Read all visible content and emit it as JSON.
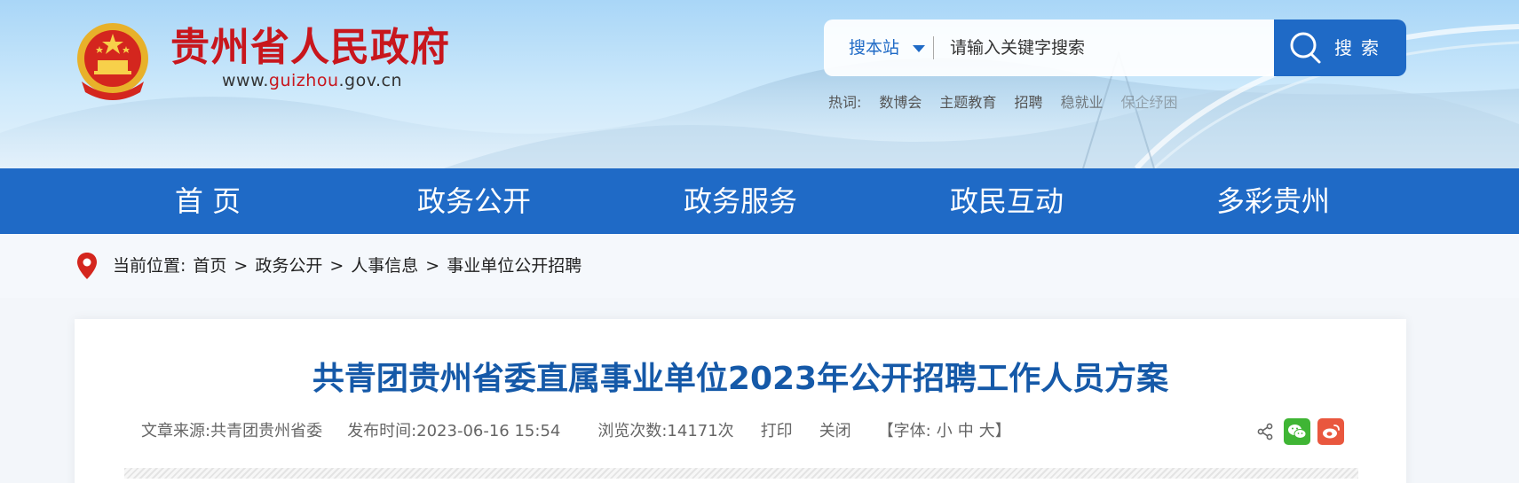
{
  "header": {
    "site_title": "贵州省人民政府",
    "domain_prefix": "www.",
    "domain_highlight": "guizhou",
    "domain_suffix": ".gov.cn"
  },
  "search": {
    "scope_label": "搜本站",
    "placeholder": "请输入关键字搜索",
    "button_label": "搜索"
  },
  "hotwords": {
    "label": "热词:",
    "items": [
      "数博会",
      "主题教育",
      "招聘",
      "稳就业",
      "保企纾困"
    ]
  },
  "nav": {
    "items": [
      "首 页",
      "政务公开",
      "政务服务",
      "政民互动",
      "多彩贵州"
    ]
  },
  "breadcrumb": {
    "label": "当前位置:",
    "items": [
      "首页",
      "政务公开",
      "人事信息",
      "事业单位公开招聘"
    ],
    "separator": ">"
  },
  "article": {
    "title": "共青团贵州省委直属事业单位2023年公开招聘工作人员方案",
    "source": "文章来源:共青团贵州省委",
    "publish_time": "发布时间:2023-06-16 15:54",
    "views": "浏览次数:14171次",
    "print": "打印",
    "close": "关闭",
    "font_label": "【字体:",
    "font_small": "小",
    "font_medium": "中",
    "font_large": "大",
    "font_end": "】"
  },
  "colors": {
    "brand_blue": "#1f6ac6",
    "title_red": "#c8161d",
    "article_title": "#1559a8"
  },
  "icons": [
    "emblem",
    "search-icon",
    "chevron-down-icon",
    "location-pin-icon",
    "share-icon",
    "wechat-icon",
    "weibo-icon"
  ]
}
